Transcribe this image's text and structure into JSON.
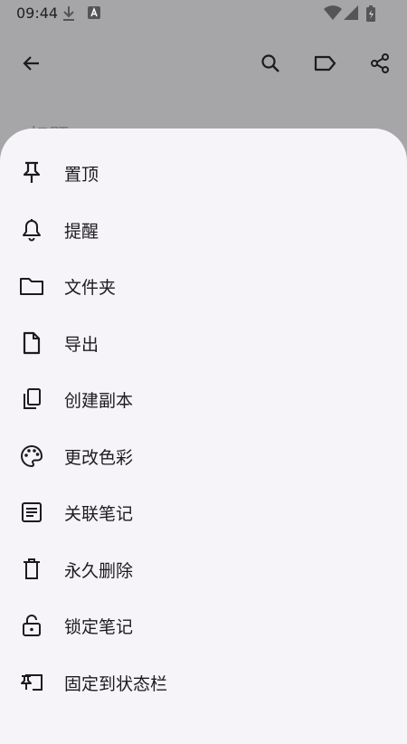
{
  "status_bar": {
    "time": "09:44",
    "icons": [
      "download-icon",
      "keyboard-a-icon",
      "wifi-icon",
      "signal-icon",
      "battery-charging-icon"
    ]
  },
  "top_bar": {
    "back_icon": "arrow-back-icon",
    "actions": [
      "search-icon",
      "label-icon",
      "share-icon"
    ]
  },
  "background_note": {
    "title_partial": "标题"
  },
  "menu": {
    "items": [
      {
        "label": "置顶",
        "icon": "pin-icon"
      },
      {
        "label": "提醒",
        "icon": "bell-icon"
      },
      {
        "label": "文件夹",
        "icon": "folder-icon"
      },
      {
        "label": "导出",
        "icon": "file-icon"
      },
      {
        "label": "创建副本",
        "icon": "copy-icon"
      },
      {
        "label": "更改色彩",
        "icon": "palette-icon"
      },
      {
        "label": "关联笔记",
        "icon": "note-link-icon"
      },
      {
        "label": "永久删除",
        "icon": "trash-icon"
      },
      {
        "label": "锁定笔记",
        "icon": "lock-open-icon"
      },
      {
        "label": "固定到状态栏",
        "icon": "pin-to-status-bar-icon"
      }
    ]
  },
  "colors": {
    "scrim": "#a6a6a8",
    "sheet_bg": "#f6f4f9",
    "text": "#1d1b20",
    "icon": "#1d1b20"
  }
}
